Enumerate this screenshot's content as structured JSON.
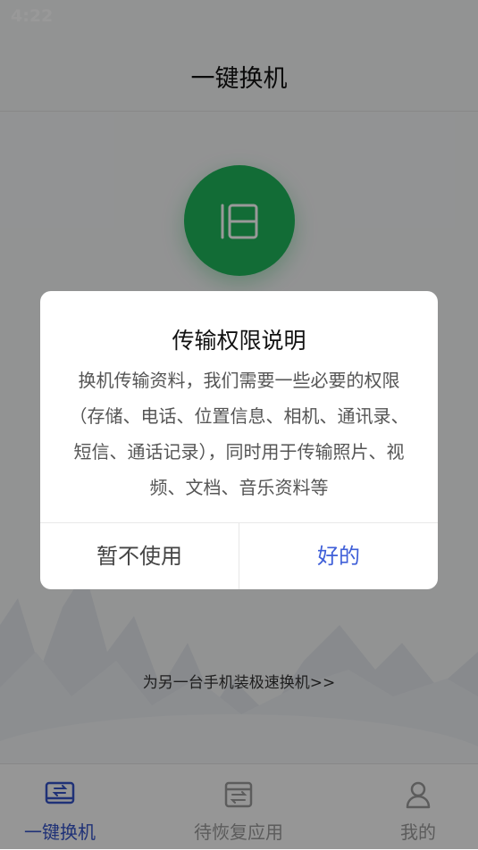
{
  "status_bar": {
    "time": "4:22"
  },
  "header": {
    "title": "一键换机"
  },
  "main": {
    "old_phone_icon": "old-phone-icon",
    "install_link": "为另一台手机装极速换机>>"
  },
  "dialog": {
    "title": "传输权限说明",
    "body": "换机传输资料，我们需要一些必要的权限（存储、电话、位置信息、相机、通讯录、短信、通话记录），同时用于传输照片、视频、文档、音乐资料等",
    "decline_label": "暂不使用",
    "ok_label": "好的"
  },
  "tabbar": {
    "tabs": [
      {
        "label": "一键换机",
        "icon": "transfer-icon",
        "active": true
      },
      {
        "label": "待恢复应用",
        "icon": "restore-icon",
        "active": false
      },
      {
        "label": "我的",
        "icon": "user-icon",
        "active": false
      }
    ]
  },
  "colors": {
    "accent": "#3553c7",
    "green": "#1fb55a",
    "ok_button": "#3f5fd8"
  }
}
